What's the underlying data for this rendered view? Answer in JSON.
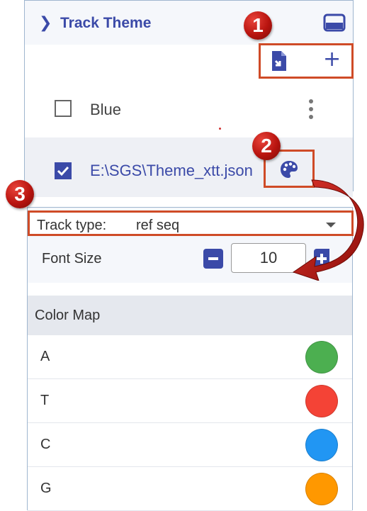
{
  "panel": {
    "title": "Track Theme",
    "themes": [
      {
        "label": "Blue",
        "checked": false
      },
      {
        "label": "E:\\SGS\\Theme_xtt.json",
        "checked": true
      }
    ]
  },
  "callouts": {
    "one": "1",
    "two": "2",
    "three": "3"
  },
  "editor": {
    "track_type_label": "Track type:",
    "track_type_value": "ref seq",
    "font_size_label": "Font Size",
    "font_size_value": "10",
    "color_map_label": "Color Map",
    "colors": [
      {
        "key": "A",
        "color": "#4caf50"
      },
      {
        "key": "T",
        "color": "#f44336"
      },
      {
        "key": "C",
        "color": "#2196f3"
      },
      {
        "key": "G",
        "color": "#ff9800"
      }
    ]
  },
  "icons": {
    "collapse": "chevron-right-icon",
    "layout": "split-layout-icon",
    "import": "file-import-icon",
    "add": "plus-icon",
    "more": "more-vertical-icon",
    "palette": "palette-icon"
  },
  "colors": {
    "accent": "#3b4aa8",
    "highlight_box": "#cf4b27",
    "badge": "#c0180f"
  }
}
